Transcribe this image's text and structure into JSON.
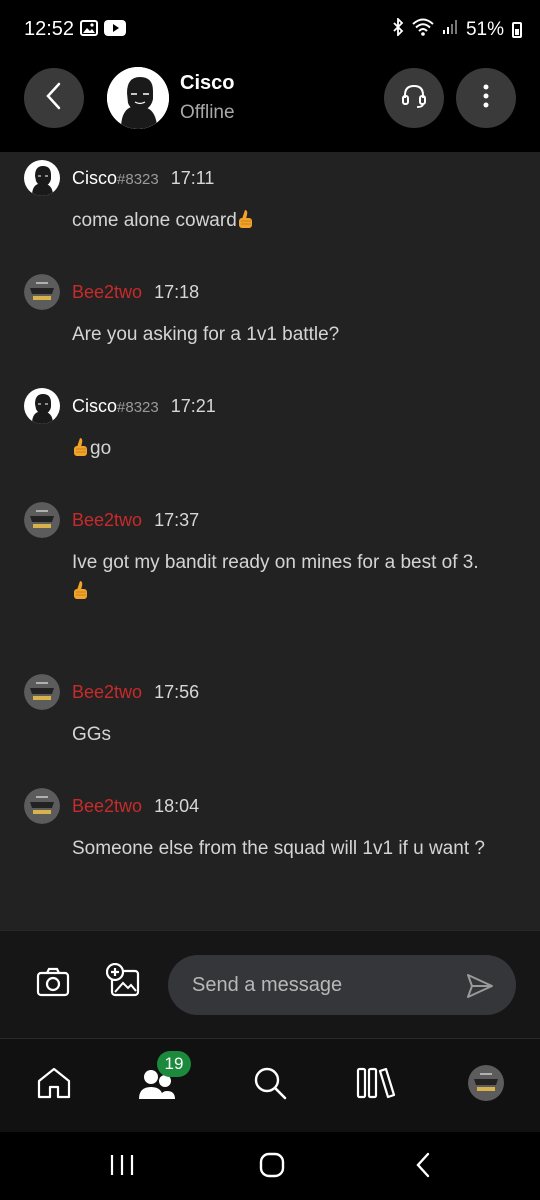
{
  "status_bar": {
    "time": "12:52",
    "battery": "51%",
    "left_icons": [
      "gallery-icon",
      "youtube-icon"
    ],
    "right_icons": [
      "bluetooth-icon",
      "wifi-icon",
      "signal-icon",
      "battery-icon"
    ]
  },
  "header": {
    "name": "Cisco",
    "status": "Offline",
    "buttons": [
      "back-icon",
      "headset-icon",
      "more-vertical-icon"
    ]
  },
  "messages": [
    {
      "user": "Cisco",
      "tag": "#8323",
      "time": "17:11",
      "text": "come alone coward",
      "emoji_after": "thumbs-up"
    },
    {
      "user": "Bee2two",
      "tag": "",
      "time": "17:18",
      "text": "Are you asking for a 1v1 battle?"
    },
    {
      "user": "Cisco",
      "tag": "#8323",
      "time": "17:21",
      "text": "go",
      "emoji_before": "thumbs-up"
    },
    {
      "user": "Bee2two",
      "tag": "",
      "time": "17:37",
      "text": "Ive got my bandit ready on mines for a best of 3.",
      "emoji_line": "thumbs-up"
    },
    {
      "user": "Bee2two",
      "tag": "",
      "time": "17:56",
      "text": "GGs"
    },
    {
      "user": "Bee2two",
      "tag": "",
      "time": "18:04",
      "text": "Someone else from the squad will 1v1 if u want ?"
    }
  ],
  "composer": {
    "placeholder": "Send a message",
    "icons": [
      "camera-icon",
      "add-image-icon",
      "send-icon"
    ]
  },
  "bottom_nav": {
    "items": [
      "home-icon",
      "friends-icon",
      "search-icon",
      "library-icon",
      "profile-avatar"
    ],
    "friends_badge": "19",
    "badge_color": "#1b8a3c"
  },
  "colors": {
    "chat_bg": "#222222",
    "username_bee": "#c92a2a",
    "username_cisco": "#ffffff"
  }
}
